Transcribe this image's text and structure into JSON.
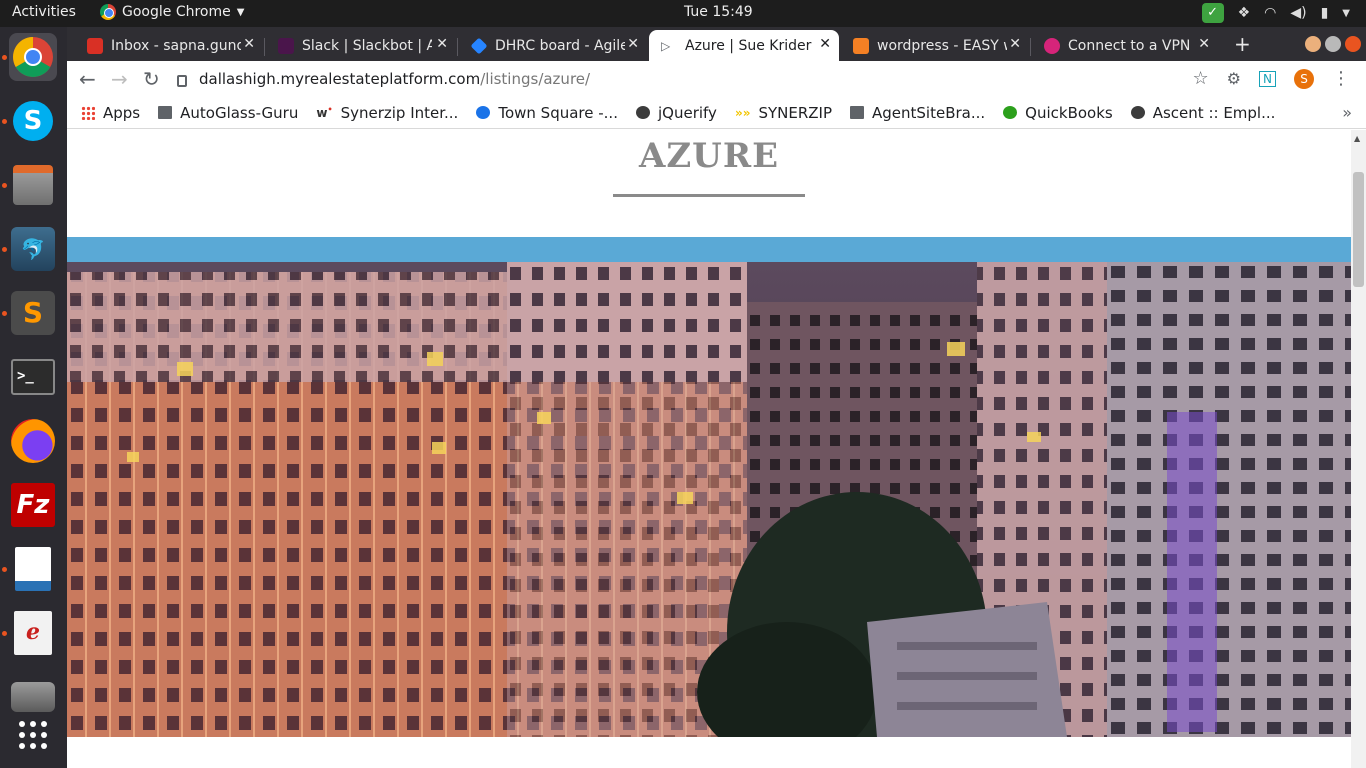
{
  "topbar": {
    "activities": "Activities",
    "app_name": "Google Chrome",
    "clock": "Tue 15:49"
  },
  "tabs": [
    {
      "title": "Inbox - sapna.gund",
      "icon": "gmail-icon",
      "color": "#d93025"
    },
    {
      "title": "Slack | Slackbot | A",
      "icon": "slack-icon",
      "color": "#4a154b"
    },
    {
      "title": "DHRC board - Agile",
      "icon": "jira-icon",
      "color": "#2684ff"
    },
    {
      "title": "Azure | Sue Krider",
      "icon": "play-icon",
      "color": "#5f6368",
      "active": true
    },
    {
      "title": "wordpress - EASY w",
      "icon": "stackoverflow-icon",
      "color": "#f48024"
    },
    {
      "title": "Connect to a VPN",
      "icon": "vpn-icon",
      "color": "#d6247a"
    }
  ],
  "omnibox": {
    "host": "dallashigh.myrealestateplatform.com",
    "path": "/listings/azure/",
    "avatar_letter": "S"
  },
  "bookmarks": [
    {
      "label": "Apps",
      "icon": "apps-grid-icon"
    },
    {
      "label": "AutoGlass-Guru",
      "icon": "folder-icon"
    },
    {
      "label": "Synerzip Inter...",
      "icon": "synerzip-w-icon"
    },
    {
      "label": "Town Square -...",
      "icon": "townsquare-icon"
    },
    {
      "label": "jQuerify",
      "icon": "globe-icon"
    },
    {
      "label": "SYNERZIP",
      "icon": "synerzip-icon"
    },
    {
      "label": "AgentSiteBra...",
      "icon": "folder-icon"
    },
    {
      "label": "QuickBooks",
      "icon": "quickbooks-icon"
    },
    {
      "label": "Ascent :: Empl...",
      "icon": "globe-icon"
    }
  ],
  "page": {
    "title": "AZURE",
    "accent_blue": "#5aa9d6",
    "title_color": "#8a8a8a"
  },
  "dock": [
    {
      "name": "chrome",
      "icon": "chrome-icon"
    },
    {
      "name": "skype",
      "icon": "skype-icon"
    },
    {
      "name": "files",
      "icon": "files-icon"
    },
    {
      "name": "mysql-workbench",
      "icon": "dolphin-icon"
    },
    {
      "name": "sublime-text",
      "icon": "sublime-icon"
    },
    {
      "name": "terminal",
      "icon": "terminal-icon"
    },
    {
      "name": "firefox",
      "icon": "firefox-icon"
    },
    {
      "name": "filezilla",
      "icon": "filezilla-icon"
    },
    {
      "name": "libreoffice-writer",
      "icon": "writer-icon"
    },
    {
      "name": "evince",
      "icon": "document-viewer-icon"
    },
    {
      "name": "settings",
      "icon": "tools-icon"
    },
    {
      "name": "show-applications",
      "icon": "app-grid-icon"
    }
  ]
}
